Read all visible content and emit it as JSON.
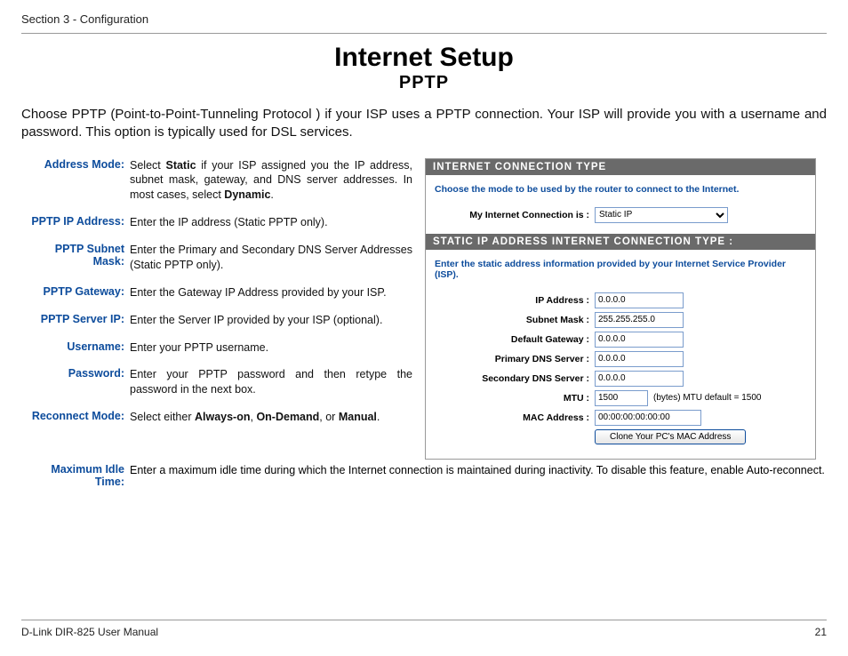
{
  "header": {
    "section": "Section 3 - Configuration"
  },
  "titles": {
    "main": "Internet Setup",
    "sub": "PPTP"
  },
  "intro": "Choose PPTP (Point-to-Point-Tunneling Protocol ) if your ISP uses a PPTP connection. Your ISP will provide you with a username and password. This option is typically used for DSL services.",
  "defs": {
    "address_mode": {
      "label": "Address Mode:",
      "pre": "Select ",
      "b1": "Static",
      "mid": " if your ISP assigned you the IP address, subnet mask, gateway, and DNS server addresses. In most cases, select ",
      "b2": "Dynamic",
      "post": "."
    },
    "ip": {
      "label": "PPTP IP Address:",
      "desc": "Enter the IP address (Static PPTP only)."
    },
    "subnet": {
      "label": "PPTP Subnet Mask:",
      "desc": "Enter the Primary and Secondary DNS Server Addresses (Static PPTP only)."
    },
    "gateway": {
      "label": "PPTP Gateway:",
      "desc": "Enter the Gateway IP Address provided by your ISP."
    },
    "server": {
      "label": "PPTP Server IP:",
      "desc": "Enter the Server IP provided by your ISP (optional)."
    },
    "user": {
      "label": "Username:",
      "desc": "Enter your PPTP username."
    },
    "pass": {
      "label": "Password:",
      "desc": "Enter your PPTP password and then retype the password in the next box."
    },
    "reconnect": {
      "label": "Reconnect Mode:",
      "pre": "Select either ",
      "b1": "Always-on",
      "c1": ", ",
      "b2": "On-Demand",
      "c2": ", or ",
      "b3": "Manual",
      "post": "."
    },
    "idle": {
      "label": "Maximum Idle Time:",
      "desc": "Enter a maximum idle time during which the Internet connection is maintained during inactivity. To disable this feature, enable Auto-reconnect."
    }
  },
  "panel": {
    "h1": "INTERNET CONNECTION TYPE",
    "t1": "Choose the mode to be used by the router to connect to the Internet.",
    "conn_label": "My Internet Connection is :",
    "conn_value": "Static IP",
    "h2": "STATIC IP ADDRESS INTERNET CONNECTION TYPE :",
    "t2": "Enter the static address information provided by your Internet Service Provider (ISP).",
    "rows": {
      "ip": {
        "label": "IP Address :",
        "value": "0.0.0.0"
      },
      "mask": {
        "label": "Subnet Mask :",
        "value": "255.255.255.0"
      },
      "gw": {
        "label": "Default Gateway :",
        "value": "0.0.0.0"
      },
      "dns1": {
        "label": "Primary DNS Server :",
        "value": "0.0.0.0"
      },
      "dns2": {
        "label": "Secondary DNS Server :",
        "value": "0.0.0.0"
      },
      "mtu": {
        "label": "MTU :",
        "value": "1500",
        "note": "(bytes) MTU default = 1500"
      },
      "mac": {
        "label": "MAC Address :",
        "value": "00:00:00:00:00:00"
      }
    },
    "clone_btn": "Clone Your PC's MAC Address"
  },
  "footer": {
    "left": "D-Link DIR-825 User Manual",
    "right": "21"
  }
}
